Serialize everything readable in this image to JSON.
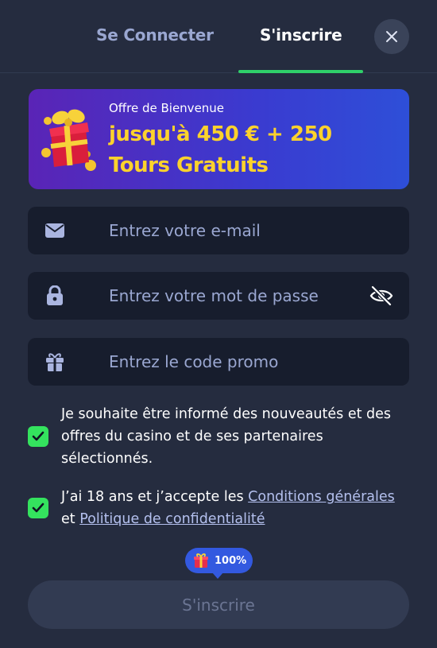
{
  "tabs": {
    "login": "Se Connecter",
    "signup": "S'inscrire",
    "active": "signup"
  },
  "banner": {
    "subtitle": "Offre de Bienvenue",
    "title": "jusqu'à 450 € + 250 Tours Gratuits"
  },
  "fields": {
    "email": {
      "placeholder": "Entrez votre e-mail",
      "icon": "envelope-icon"
    },
    "password": {
      "placeholder": "Entrez votre mot de passe",
      "icon": "lock-icon",
      "toggle_icon": "eye-slash-icon"
    },
    "promo": {
      "placeholder": "Entrez le code promo",
      "icon": "gift-icon"
    }
  },
  "checkboxes": {
    "newsletter": {
      "checked": true,
      "text": "Je souhaite être informé des nouveautés et des offres du casino et de ses partenaires sélectionnés."
    },
    "terms": {
      "checked": true,
      "prefix": "J’ai 18 ans et j’accepte les ",
      "link1": "Conditions générales",
      "middle": " et ",
      "link2": "Politique de confidentialité"
    }
  },
  "progress": {
    "value": 100,
    "label": "100%"
  },
  "submit": {
    "label": "S'inscrire",
    "enabled": false
  },
  "colors": {
    "background": "#252c3f",
    "field": "#171d2d",
    "accent_green": "#2fd06a",
    "checkbox": "#34e35e",
    "banner_gold": "#fcd22c",
    "badge_blue": "#3359e0"
  }
}
